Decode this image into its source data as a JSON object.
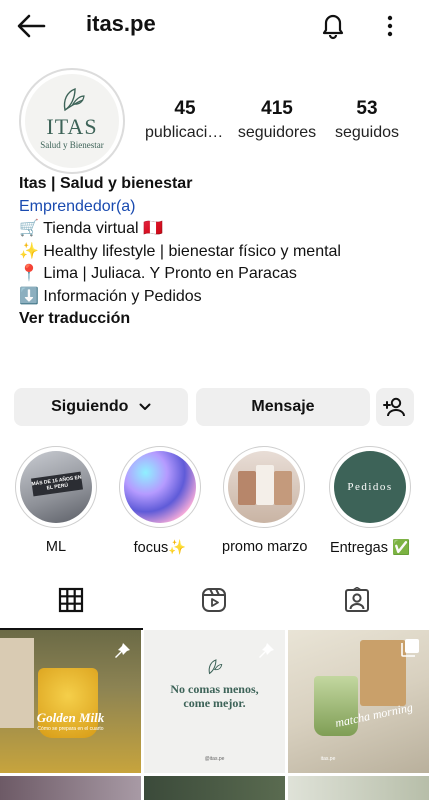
{
  "header": {
    "username": "itas.pe",
    "back_icon": "arrow-left-icon",
    "notifications_icon": "bell-icon",
    "more_icon": "more-vertical-icon"
  },
  "profile": {
    "avatar": {
      "brand": "ITAS",
      "tagline": "Salud y Bienestar"
    },
    "stats": [
      {
        "value": "45",
        "label": "publicaciones"
      },
      {
        "value": "415",
        "label": "seguidores"
      },
      {
        "value": "53",
        "label": "seguidos"
      }
    ],
    "bio": {
      "name": "Itas | Salud y bienestar",
      "category": "Emprendedor(a)",
      "lines": [
        "🛒 Tienda virtual 🇵🇪",
        "✨ Healthy lifestyle | bienestar físico y mental",
        "📍 Lima | Juliaca. Y Pronto en Paracas",
        "⬇️ Información y Pedidos"
      ],
      "translate_label": "Ver traducción"
    }
  },
  "actions": {
    "following_label": "Siguiendo",
    "message_label": "Mensaje",
    "add_user_icon": "add-user-icon"
  },
  "highlights": [
    {
      "label": "ML",
      "image_text": "MÁS DE 15 AÑOS EN EL PERÚ"
    },
    {
      "label": "focus✨"
    },
    {
      "label": "promo marzo"
    },
    {
      "label": "Entregas ✅",
      "image_text": "Pedidos"
    }
  ],
  "tabs": [
    {
      "name": "posts-grid",
      "icon": "grid-icon",
      "active": true
    },
    {
      "name": "reels",
      "icon": "reels-icon",
      "active": false
    },
    {
      "name": "tagged",
      "icon": "tagged-user-icon",
      "active": false
    }
  ],
  "posts": [
    {
      "title": "Golden Milk",
      "subtitle": "Cómo se prepara en el cuarto",
      "pinned": true
    },
    {
      "title": "No comas menos, come mejor.",
      "handle": "@itas.pe",
      "pinned": true
    },
    {
      "title": "matcha morning",
      "handle": "itas.pe",
      "multi": true
    }
  ],
  "colors": {
    "brand_green": "#3d6358",
    "link_blue": "#1a4bb0",
    "button_bg": "#efefef"
  }
}
